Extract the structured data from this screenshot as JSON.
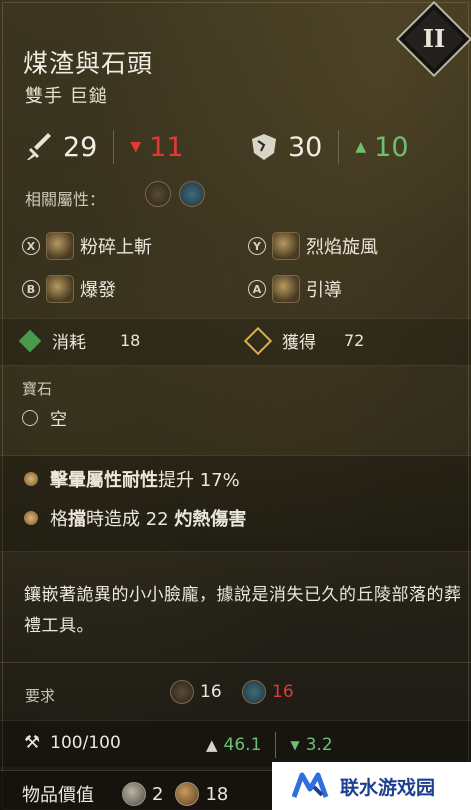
{
  "item": {
    "name": "煤渣與石頭",
    "type": "雙手 巨鎚",
    "tier": "II"
  },
  "stats": {
    "damage": "29",
    "damage_diff": "11",
    "poise": "30",
    "poise_diff": "10"
  },
  "attributes": {
    "label": "相關屬性："
  },
  "skills": [
    {
      "button": "X",
      "name": "粉碎上斬"
    },
    {
      "button": "Y",
      "name": "烈焰旋風"
    },
    {
      "button": "B",
      "name": "爆發"
    },
    {
      "button": "A",
      "name": "引導"
    }
  ],
  "focus": {
    "cost_label": "消耗",
    "cost_value": "18",
    "gain_label": "獲得",
    "gain_value": "72"
  },
  "gem": {
    "label": "寶石",
    "slot": "空"
  },
  "perks": [
    {
      "pre": "",
      "bold": "擊暈屬性耐性",
      "post": "提升 17%"
    },
    {
      "pre": "格",
      "bold": "擋",
      "post": "時造成 22 ",
      "bold2": "灼熱傷害"
    }
  ],
  "description": "鑲嵌著詭異的小小臉龐，據說是消失已久的丘陵部落的葬禮工具。",
  "requirements": {
    "label": "要求",
    "str": "16",
    "int": "16"
  },
  "durability": {
    "value": "100/100",
    "weight": "46.1",
    "weight_diff": "3.2"
  },
  "value": {
    "label": "物品價值",
    "coin1": "2",
    "coin2": "18"
  },
  "watermark": {
    "text": "联水游戏园"
  },
  "colors": {
    "red": "#e23a33",
    "green": "#6fbf70"
  }
}
